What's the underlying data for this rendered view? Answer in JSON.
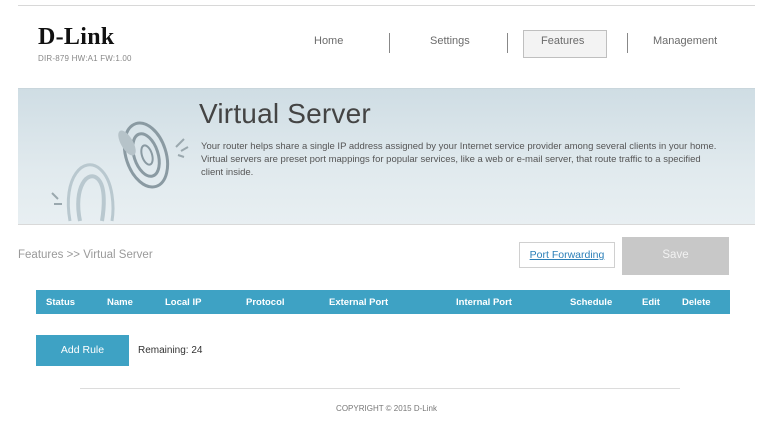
{
  "brand": {
    "logo": "D-Link",
    "model": "DIR-879 HW:A1 FW:1.00"
  },
  "nav": {
    "items": [
      {
        "label": "Home"
      },
      {
        "label": "Settings"
      },
      {
        "label": "Features",
        "active": true
      },
      {
        "label": "Management"
      }
    ]
  },
  "banner": {
    "title": "Virtual Server",
    "description": "Your router helps share a single IP address assigned by your Internet service provider among several clients in your home. Virtual servers are preset port mappings for popular services, like a web or e-mail server, that route traffic to a specified client inside."
  },
  "breadcrumb": "Features >> Virtual Server",
  "actions": {
    "port_forwarding": "Port Forwarding",
    "save": "Save"
  },
  "table": {
    "columns": [
      "Status",
      "Name",
      "Local IP",
      "Protocol",
      "External Port",
      "Internal Port",
      "Schedule",
      "Edit",
      "Delete"
    ],
    "rows": []
  },
  "add_rule": {
    "label": "Add Rule",
    "remaining_label": "Remaining:",
    "remaining_count": "24",
    "remaining_text": "Remaining: 24"
  },
  "footer": {
    "copyright": "COPYRIGHT © 2015 D-Link"
  },
  "colors": {
    "accent": "#3ea2c4",
    "save_disabled": "#c8c8c8",
    "link": "#2b7fb8"
  }
}
